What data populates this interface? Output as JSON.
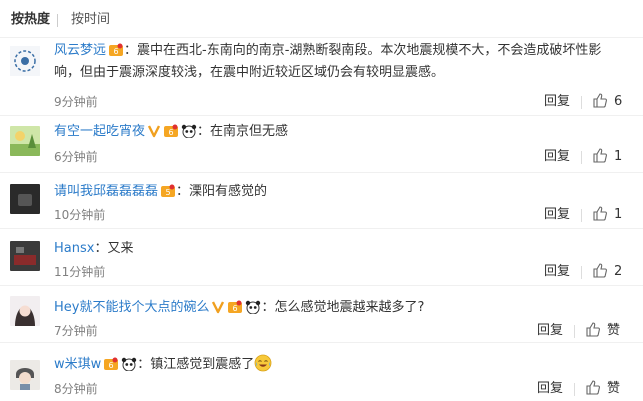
{
  "sort": {
    "hot": "按热度",
    "time": "按时间"
  },
  "reply_label": "回复",
  "colors": {
    "username": "#2b7bc9",
    "muted": "#808080",
    "text": "#333333",
    "vip_orange": "#f0a020"
  },
  "comments": [
    {
      "user": "风云梦远",
      "text_line1": "：震中在西北-东南向的南京-湖熟断裂南段。本次地震规模不大，不会造成破坏性影",
      "text_line2": "响，但由于震源深度较浅，在震中附近较近区域仍会有较明显震感。",
      "time": "9分钟前",
      "likes": "6"
    },
    {
      "user": "有空一起吃宵夜",
      "text_line1": "：在南京但无感",
      "time": "6分钟前",
      "likes": "1"
    },
    {
      "user": "请叫我邱磊磊磊磊",
      "text_line1": "：溧阳有感觉的",
      "time": "10分钟前",
      "likes": "1"
    },
    {
      "user": "Hansx",
      "text_line1": "：又来",
      "time": "11分钟前",
      "likes": "2"
    },
    {
      "user": "Hey就不能找个大点的碗么",
      "text_line1": "：怎么感觉地震越来越多了?",
      "time": "7分钟前",
      "likes": "赞"
    },
    {
      "user": "w米琪w",
      "text_line1": "：镇江感觉到震感了",
      "time": "8分钟前",
      "likes": "赞"
    }
  ]
}
